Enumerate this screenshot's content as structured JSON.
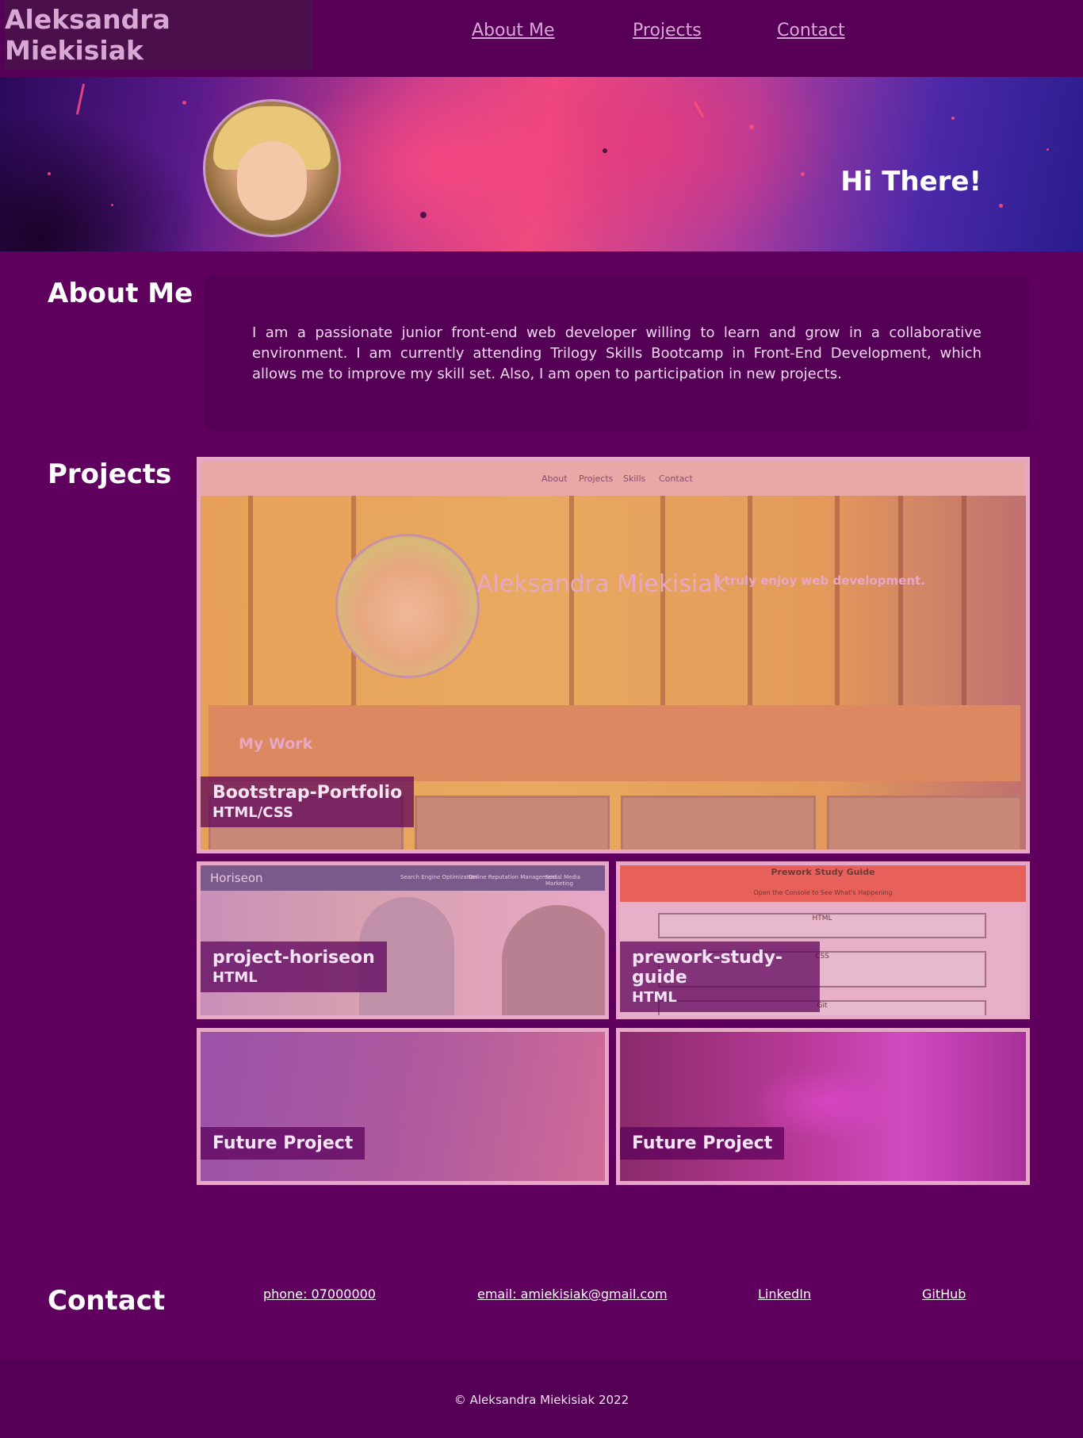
{
  "header": {
    "brand": "Aleksandra Miekisiak",
    "nav": [
      "About Me",
      "Projects",
      "Contact"
    ]
  },
  "hero": {
    "greeting": "Hi There!"
  },
  "about": {
    "title": "About Me",
    "text": "I am a passionate junior front-end web developer willing to learn and grow in a collaborative environment. I am currently attending Trilogy Skills Bootcamp in Front-End Development, which allows me to improve my skill set. Also, I am open to participation in new projects."
  },
  "projects": {
    "title": "Projects",
    "items": [
      {
        "name": "Bootstrap-Portfolio",
        "tech": "HTML/CSS",
        "thumb": {
          "nav": [
            "About",
            "Projects",
            "Skills",
            "Contact"
          ],
          "name": "Aleksandra Miekisiak",
          "tagline": "I truly enjoy web development.",
          "section": "My Work"
        }
      },
      {
        "name": "project-horiseon",
        "tech": "HTML",
        "thumb": {
          "brand": "Horiseon",
          "nav": [
            "Search Engine Optimization",
            "Online Reputation Management",
            "Social Media Marketing"
          ]
        }
      },
      {
        "name": "prework-study-guide",
        "tech": "HTML",
        "thumb": {
          "title": "Prework Study Guide",
          "subtitle": "Open the Console to See What's Happening",
          "sections": [
            "HTML",
            "CSS",
            "Git"
          ]
        }
      },
      {
        "name": "Future Project"
      },
      {
        "name": "Future Project"
      }
    ]
  },
  "contact": {
    "title": "Contact",
    "links": [
      "phone: 07000000",
      "email: amiekisiak@gmail.com",
      "LinkedIn",
      "GitHub"
    ]
  },
  "footer": {
    "text": "© Aleksandra Miekisiak 2022"
  },
  "colors": {
    "background": "#5f005f",
    "header": "#580058",
    "card_border": "#e6a8c6",
    "brand_text": "#d8a8d4"
  }
}
